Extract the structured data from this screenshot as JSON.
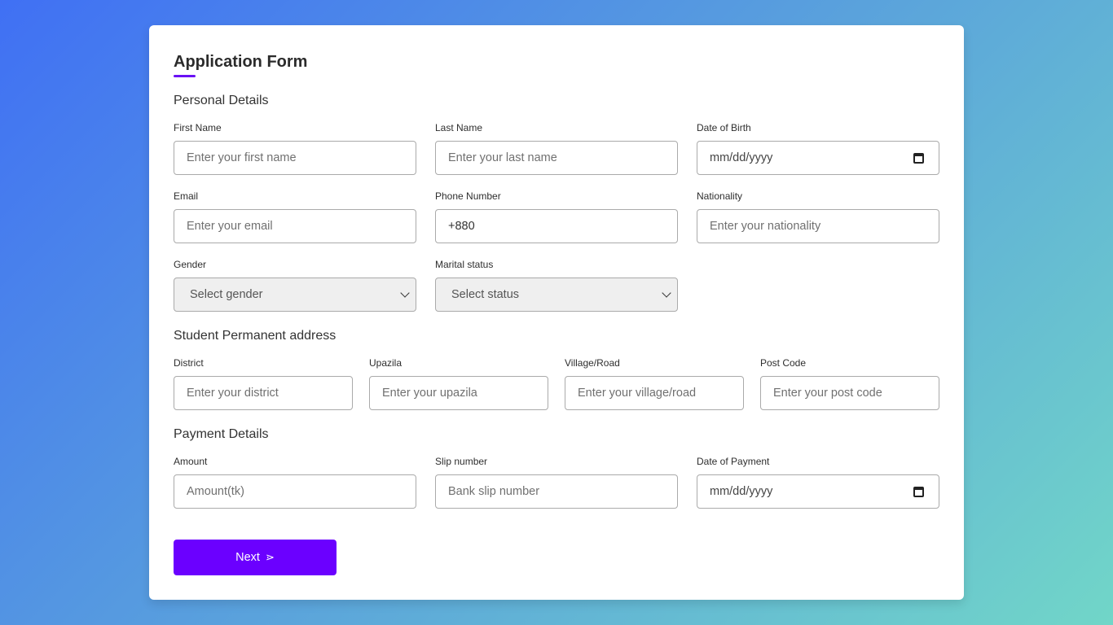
{
  "form": {
    "title": "Application Form",
    "sections": {
      "personal": "Personal Details",
      "address": "Student Permanent address",
      "payment": "Payment Details"
    },
    "fields": {
      "first_name": {
        "label": "First Name",
        "placeholder": "Enter your first name"
      },
      "last_name": {
        "label": "Last Name",
        "placeholder": "Enter your last name"
      },
      "dob": {
        "label": "Date of Birth",
        "value": "mm/dd/yyyy"
      },
      "email": {
        "label": "Email",
        "placeholder": "Enter your email"
      },
      "phone": {
        "label": "Phone Number",
        "value": "+880"
      },
      "nationality": {
        "label": "Nationality",
        "placeholder": "Enter your nationality"
      },
      "gender": {
        "label": "Gender",
        "value": "Select gender"
      },
      "marital": {
        "label": "Marital status",
        "value": "Select status"
      },
      "district": {
        "label": "District",
        "placeholder": "Enter your district"
      },
      "upazila": {
        "label": "Upazila",
        "placeholder": "Enter your upazila"
      },
      "village": {
        "label": "Village/Road",
        "placeholder": "Enter your village/road"
      },
      "postcode": {
        "label": "Post Code",
        "placeholder": "Enter your post code"
      },
      "amount": {
        "label": "Amount",
        "placeholder": "Amount(tk)"
      },
      "slip": {
        "label": "Slip number",
        "placeholder": "Bank slip number"
      },
      "payment_date": {
        "label": "Date of Payment",
        "value": "mm/dd/yyyy"
      }
    },
    "next_label": "Next",
    "next_icon": "⋗"
  },
  "colors": {
    "accent": "#6b00ff",
    "underline": "#6a11f5",
    "gradient_start": "#4070f4",
    "gradient_end": "#71d6c8"
  }
}
